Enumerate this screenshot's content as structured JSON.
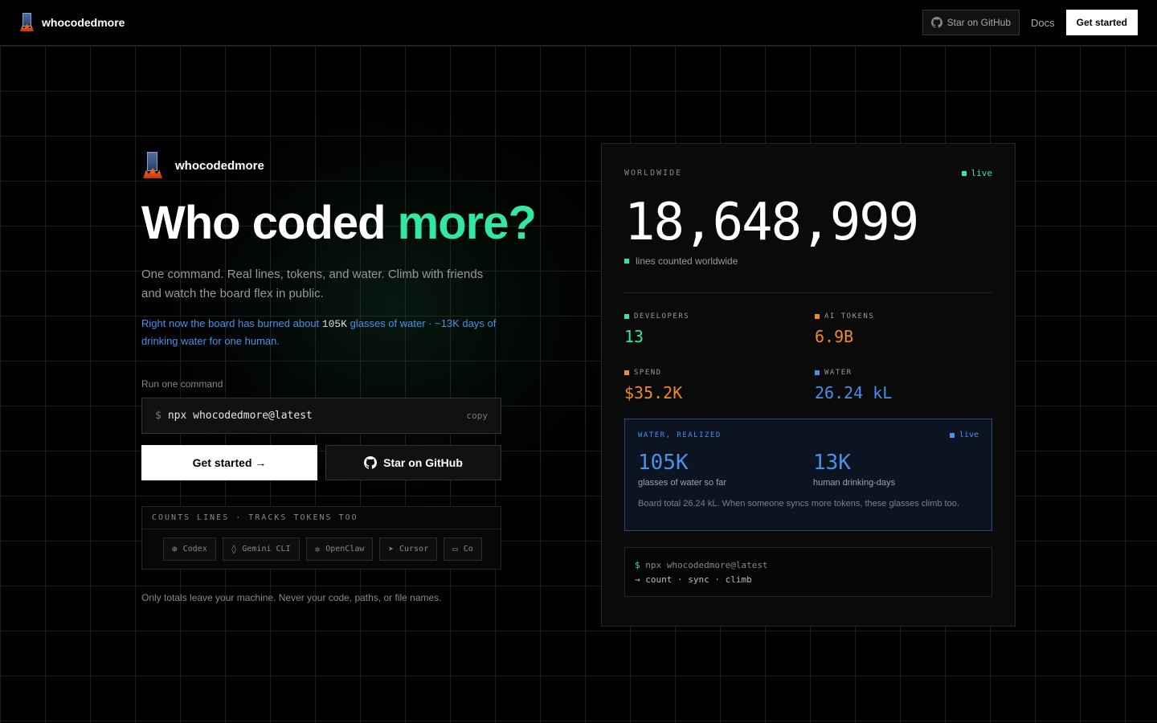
{
  "nav": {
    "brand": "whocodedmore",
    "github_label": "Star on GitHub",
    "docs_label": "Docs",
    "start_label": "Get started"
  },
  "hero": {
    "brand": "whocodedmore",
    "headline_main": "Who coded ",
    "headline_accent": "more?",
    "subtitle": "One command. Real lines, tokens, and water. Climb with friends and watch the board flex in public.",
    "water_pre": "Right now the board has burned about ",
    "water_highlight": "105K",
    "water_post": " glasses of water · ~13K days of drinking water for one human.",
    "command_label": "Run one command",
    "command_prompt": "$",
    "command": "npx whocodedmore@latest",
    "copy_label": "copy",
    "primary_button": "Get started →",
    "secondary_button": "Star on GitHub",
    "tools_heading": "COUNTS LINES · TRACKS TOKENS TOO",
    "tools": [
      {
        "icon": "codex-icon",
        "label": "Codex"
      },
      {
        "icon": "gemini-icon",
        "label": "Gemini CLI"
      },
      {
        "icon": "openclaw-icon",
        "label": "OpenClaw"
      },
      {
        "icon": "cursor-icon",
        "label": "Cursor"
      },
      {
        "icon": "terminal-icon",
        "label": "Co"
      }
    ],
    "privacy": "Only totals leave your machine. Never your code, paths, or file names."
  },
  "card": {
    "eyebrow": "WORLDWIDE",
    "live": "live",
    "total": "18,648,999",
    "total_label": "lines counted worldwide",
    "stats": [
      {
        "label": "DEVELOPERS",
        "value": "13",
        "color": "#34e6a0"
      },
      {
        "label": "AI TOKENS",
        "value": "6.9B",
        "color": "#f08a24"
      },
      {
        "label": "SPEND",
        "value": "$35.2K",
        "color": "#f08a24"
      },
      {
        "label": "WATER",
        "value": "26.24 kL",
        "color": "#4a90e6"
      }
    ],
    "water": {
      "eyebrow": "WATER, REALIZED",
      "live": "live",
      "glasses_value": "105K",
      "glasses_label": "glasses of water so far",
      "days_value": "13K",
      "days_label": "human drinking-days",
      "note": "Board total 26.24 kL. When someone syncs more tokens, these glasses climb too."
    },
    "terminal": {
      "prompt": "$",
      "line1": " npx whocodedmore@latest",
      "line2": "→ count · sync · climb"
    }
  },
  "colors": {
    "accent_green": "#34e6a0",
    "accent_orange": "#f08a24",
    "accent_blue": "#4a90e6"
  }
}
